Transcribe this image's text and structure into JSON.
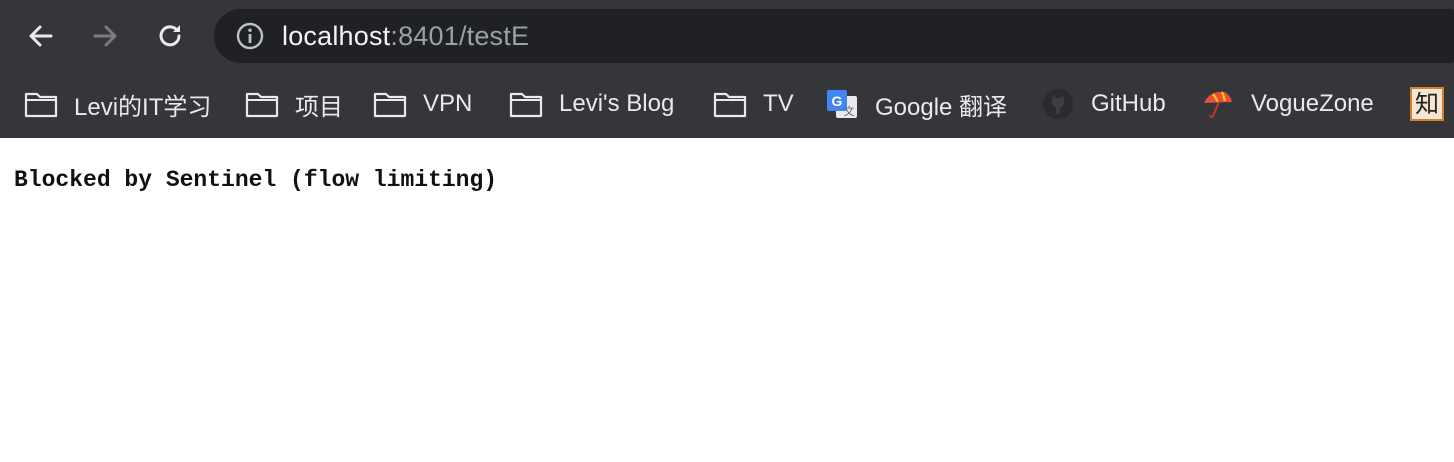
{
  "browser": {
    "url_host": "localhost",
    "url_rest": ":8401/testE"
  },
  "bookmarks": [
    {
      "label": "Levi的IT学习",
      "icon": "folder-icon"
    },
    {
      "label": "项目",
      "icon": "folder-icon"
    },
    {
      "label": "VPN",
      "icon": "folder-icon"
    },
    {
      "label": "Levi's Blog",
      "icon": "folder-icon"
    },
    {
      "label": "TV",
      "icon": "folder-icon"
    },
    {
      "label": "Google 翻译",
      "icon": "google-translate-icon"
    },
    {
      "label": "GitHub",
      "icon": "github-icon"
    },
    {
      "label": "VogueZone",
      "icon": "umbrella-icon"
    },
    {
      "label": "知",
      "icon": "zhihu-icon"
    }
  ],
  "page": {
    "message": "Blocked by Sentinel (flow limiting)"
  },
  "colors": {
    "toolbar_bg": "#35363a",
    "omnibox_bg": "#202124",
    "text_light": "#e8eaed",
    "url_dim": "#9aa0a6"
  }
}
